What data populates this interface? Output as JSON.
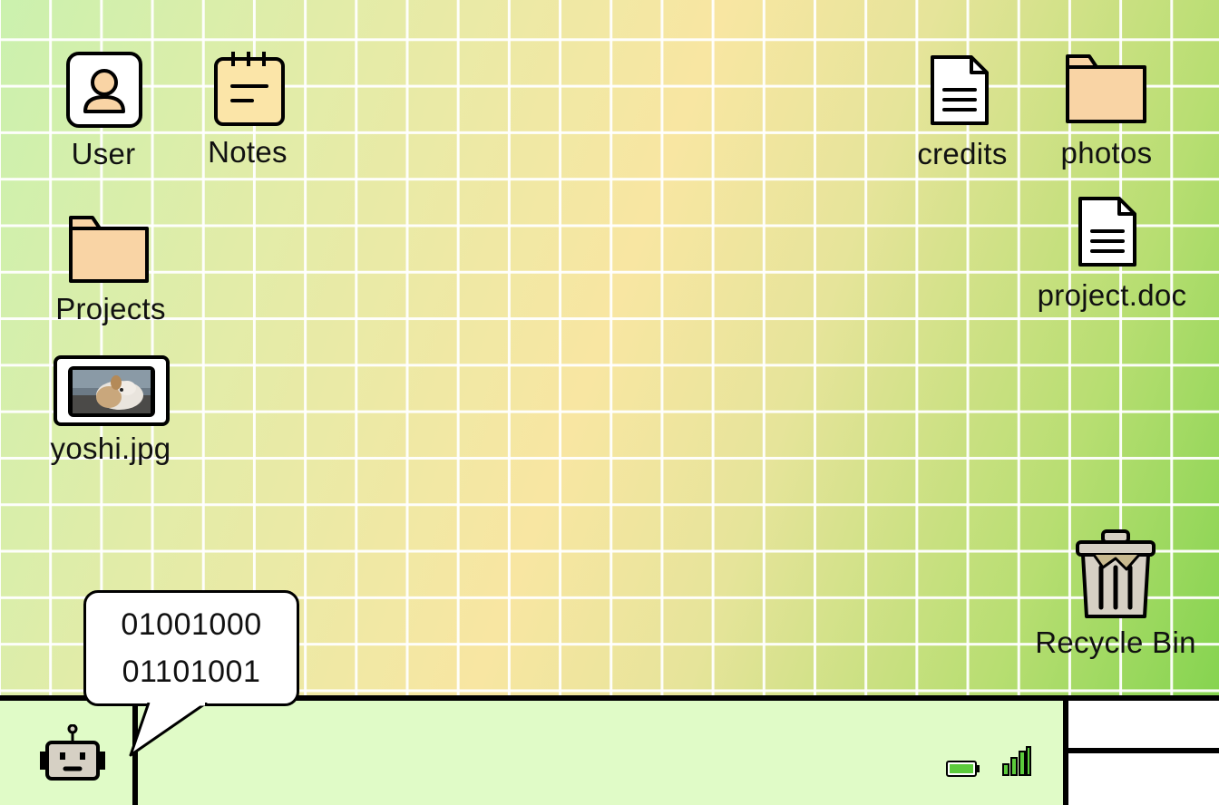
{
  "desktop": {
    "icons": {
      "user": {
        "label": "User",
        "icon": "user-profile-icon"
      },
      "notes": {
        "label": "Notes",
        "icon": "notepad-icon"
      },
      "projects": {
        "label": "Projects",
        "icon": "folder-icon"
      },
      "yoshi": {
        "label": "yoshi.jpg",
        "icon": "image-thumbnail-icon"
      },
      "credits": {
        "label": "credits",
        "icon": "document-icon"
      },
      "photos": {
        "label": "photos",
        "icon": "folder-icon"
      },
      "project_doc": {
        "label": "project.doc",
        "icon": "document-icon"
      },
      "recycle_bin": {
        "label": "Recycle Bin",
        "icon": "trash-icon"
      }
    }
  },
  "assistant": {
    "icon": "robot-icon",
    "speech_lines": [
      "01001000",
      "01101001"
    ]
  },
  "taskbar": {
    "battery_icon": "battery-icon",
    "signal_icon": "signal-strength-icon"
  },
  "colors": {
    "folder": "#f9d4a5",
    "notes": "#fbe5a8",
    "taskbar": "#e0fbc7",
    "battery_fill": "#5ccb3c",
    "signal_fill": "#5ccb3c",
    "robot": "#d6d0c4"
  }
}
